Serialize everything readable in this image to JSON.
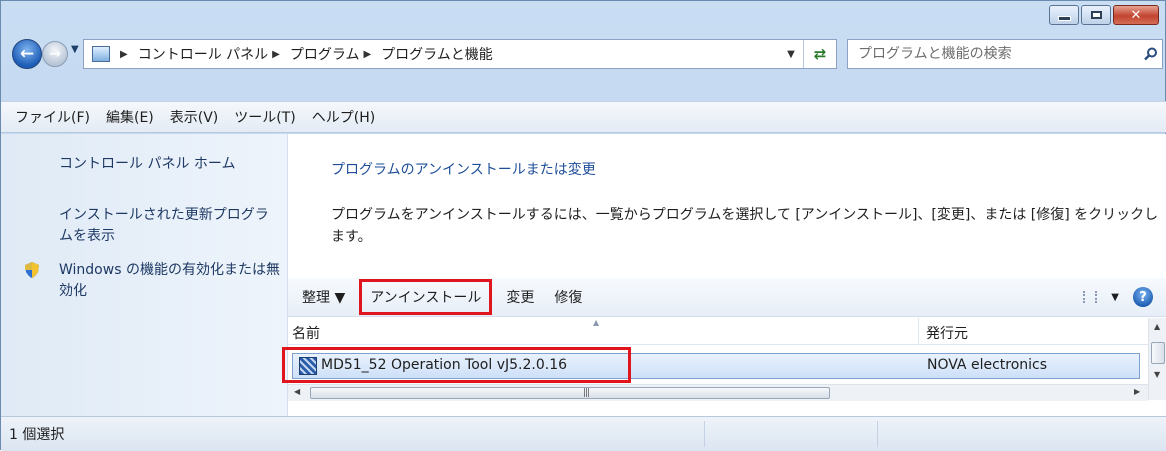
{
  "window": {
    "caption_buttons": {
      "minimize": "minimize",
      "maximize": "maximize",
      "close": "✕"
    }
  },
  "nav": {
    "back_icon": "back-arrow-icon",
    "forward_icon": "forward-arrow-icon",
    "breadcrumbs": [
      "コントロール パネル",
      "プログラム",
      "プログラムと機能"
    ],
    "search_placeholder": "プログラムと機能の検索"
  },
  "menu": {
    "items": [
      "ファイル(F)",
      "編集(E)",
      "表示(V)",
      "ツール(T)",
      "ヘルプ(H)"
    ]
  },
  "sidebar": {
    "items": [
      {
        "label": "コントロール パネル ホーム"
      },
      {
        "label": "インストールされた更新プログラムを表示"
      },
      {
        "label": "Windows の機能の有効化または無効化"
      }
    ]
  },
  "main": {
    "heading": "プログラムのアンインストールまたは変更",
    "instructions": "プログラムをアンインストールするには、一覧からプログラムを選択して [アンインストール]、[変更]、または [修復] をクリックします。",
    "toolbar": {
      "organize": "整理 ▼",
      "uninstall": "アンインストール",
      "change": "変更",
      "repair": "修復",
      "view_dropdown": "▼",
      "help": "?"
    },
    "columns": {
      "name": "名前",
      "publisher": "発行元"
    },
    "programs": [
      {
        "name": "MD51_52 Operation Tool vJ5.2.0.16",
        "publisher": "NOVA electronics"
      }
    ]
  },
  "status": {
    "selection": "1 個選択"
  },
  "colors": {
    "accent_link": "#1e4e99",
    "highlight_box": "#e0161f",
    "selected_row": "#cde0f8"
  }
}
